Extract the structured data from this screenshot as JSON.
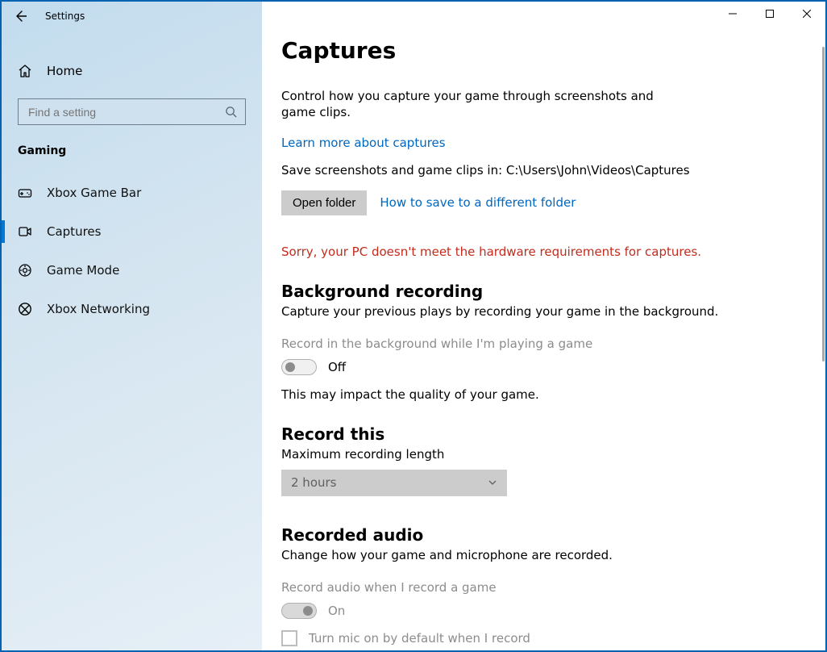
{
  "window": {
    "title": "Settings"
  },
  "sidebar": {
    "home_label": "Home",
    "search_placeholder": "Find a setting",
    "category": "Gaming",
    "items": [
      {
        "label": "Xbox Game Bar",
        "active": false
      },
      {
        "label": "Captures",
        "active": true
      },
      {
        "label": "Game Mode",
        "active": false
      },
      {
        "label": "Xbox Networking",
        "active": false
      }
    ]
  },
  "page": {
    "title": "Captures",
    "description": "Control how you capture your game through screenshots and game clips.",
    "learn_more": "Learn more about captures",
    "save_location_line": "Save screenshots and game clips in: C:\\Users\\John\\Videos\\Captures",
    "open_folder_btn": "Open folder",
    "how_to_save_link": "How to save to a different folder",
    "error": "Sorry, your PC doesn't meet the hardware requirements for captures.",
    "bg": {
      "heading": "Background recording",
      "sub": "Capture your previous plays by recording your game in the background.",
      "toggle_label": "Record in the background while I'm playing a game",
      "toggle_state": "Off",
      "note": "This may impact the quality of your game."
    },
    "record_this": {
      "heading": "Record this",
      "sub": "Maximum recording length",
      "select_value": "2 hours"
    },
    "audio": {
      "heading": "Recorded audio",
      "sub": "Change how your game and microphone are recorded.",
      "toggle_label": "Record audio when I record a game",
      "toggle_state": "On",
      "mic_checkbox_label": "Turn mic on by default when I record"
    }
  }
}
